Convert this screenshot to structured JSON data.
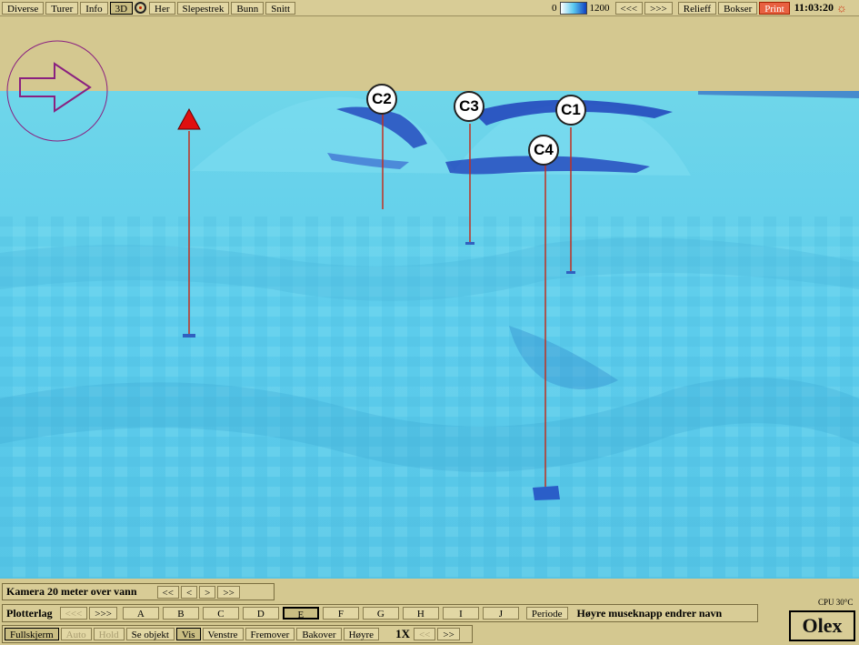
{
  "toolbar": {
    "items": [
      "Diverse",
      "Turer",
      "Info",
      "3D",
      "Her",
      "Slepestrek",
      "Bunn",
      "Snitt"
    ],
    "scale_min": "0",
    "scale_max": "1200",
    "prev": "<<<",
    "next": ">>>",
    "relief": "Relieff",
    "boxes": "Bokser",
    "print": "Print",
    "clock": "11:03:20"
  },
  "markers": [
    "C2",
    "C3",
    "C1",
    "C4"
  ],
  "camera": {
    "text": "Kamera 20 meter over vann",
    "buttons": [
      "<<",
      "<",
      ">",
      ">>"
    ]
  },
  "plotter": {
    "label": "Plotterlag",
    "prev": "<<<",
    "next": ">>>",
    "layers": [
      "A",
      "B",
      "C",
      "D",
      "E",
      "F",
      "G",
      "H",
      "I",
      "J"
    ],
    "active_layer": "E",
    "period": "Periode",
    "hint": "Høyre museknapp endrer navn"
  },
  "bottom": {
    "items": [
      "Fullskjerm",
      "Auto",
      "Hold",
      "Se objekt",
      "Vis",
      "Venstre",
      "Fremover",
      "Bakover",
      "Høyre"
    ],
    "speed": "1X",
    "prev": "<<",
    "next": ">>"
  },
  "cpu": "CPU 30°C",
  "logo": "Olex",
  "colors": {
    "sea": "#63d3e8",
    "deep": "#1c38b8",
    "land": "#d4c890",
    "pin": "#c03020",
    "compass": "#8a2080"
  }
}
